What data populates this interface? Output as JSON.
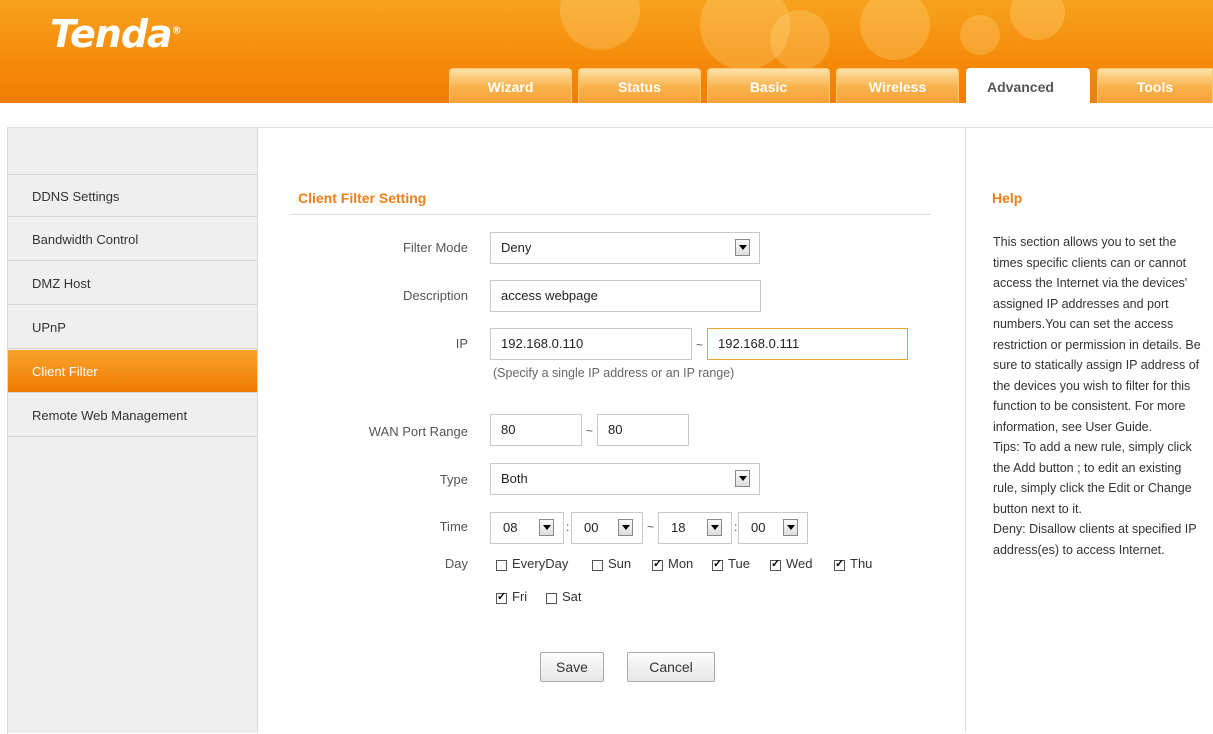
{
  "brand": {
    "logo_text": "Tenda",
    "logo_mark": "®"
  },
  "nav_tabs": [
    {
      "label": "Wizard",
      "active": false
    },
    {
      "label": "Status",
      "active": false
    },
    {
      "label": "Basic",
      "active": false
    },
    {
      "label": "Wireless",
      "active": false
    },
    {
      "label": "Advanced",
      "active": true
    },
    {
      "label": "Tools",
      "active": false
    }
  ],
  "sidebar": {
    "items": [
      {
        "label": "DDNS Settings",
        "active": false
      },
      {
        "label": "Bandwidth Control",
        "active": false
      },
      {
        "label": "DMZ Host",
        "active": false
      },
      {
        "label": "UPnP",
        "active": false
      },
      {
        "label": "Client Filter",
        "active": true
      },
      {
        "label": "Remote Web Management",
        "active": false
      }
    ]
  },
  "form": {
    "section_title": "Client Filter Setting",
    "filter_mode": {
      "label": "Filter Mode",
      "value": "Deny"
    },
    "description": {
      "label": "Description",
      "value": "access webpage"
    },
    "ip": {
      "label": "IP",
      "start": "192.168.0.110",
      "separator": "~",
      "end": "192.168.0.111",
      "hint": "(Specify a single IP address or an IP range)"
    },
    "wan_port": {
      "label": "WAN Port Range",
      "start": "80",
      "separator": "~",
      "end": "80"
    },
    "type": {
      "label": "Type",
      "value": "Both"
    },
    "time": {
      "label": "Time",
      "start_hour": "08",
      "start_min": "00",
      "separator": "~",
      "end_hour": "18",
      "end_min": "00",
      "colon": ":"
    },
    "day": {
      "label": "Day",
      "options": [
        {
          "label": "EveryDay",
          "checked": false
        },
        {
          "label": "Sun",
          "checked": false
        },
        {
          "label": "Mon",
          "checked": true
        },
        {
          "label": "Tue",
          "checked": true
        },
        {
          "label": "Wed",
          "checked": true
        },
        {
          "label": "Thu",
          "checked": true
        },
        {
          "label": "Fri",
          "checked": true
        },
        {
          "label": "Sat",
          "checked": false
        }
      ]
    },
    "save_label": "Save",
    "cancel_label": "Cancel"
  },
  "help": {
    "title": "Help",
    "text": "This section allows you to set the times specific clients can or cannot access the Internet via the devices' assigned IP addresses and port numbers.You can set the access restriction or permission in details. Be sure to statically assign IP address of the devices you wish to filter for this function to be consistent. For more information, see User Guide.\nTips: To add a new rule, simply click the Add button ; to edit an existing rule, simply click the Edit or Change button next to it.\nDeny: Disallow clients at specified IP address(es) to access Internet."
  },
  "colors": {
    "brand_orange": "#f58a0a",
    "accent_text": "#f07f14",
    "active_item": "#f07a02"
  }
}
